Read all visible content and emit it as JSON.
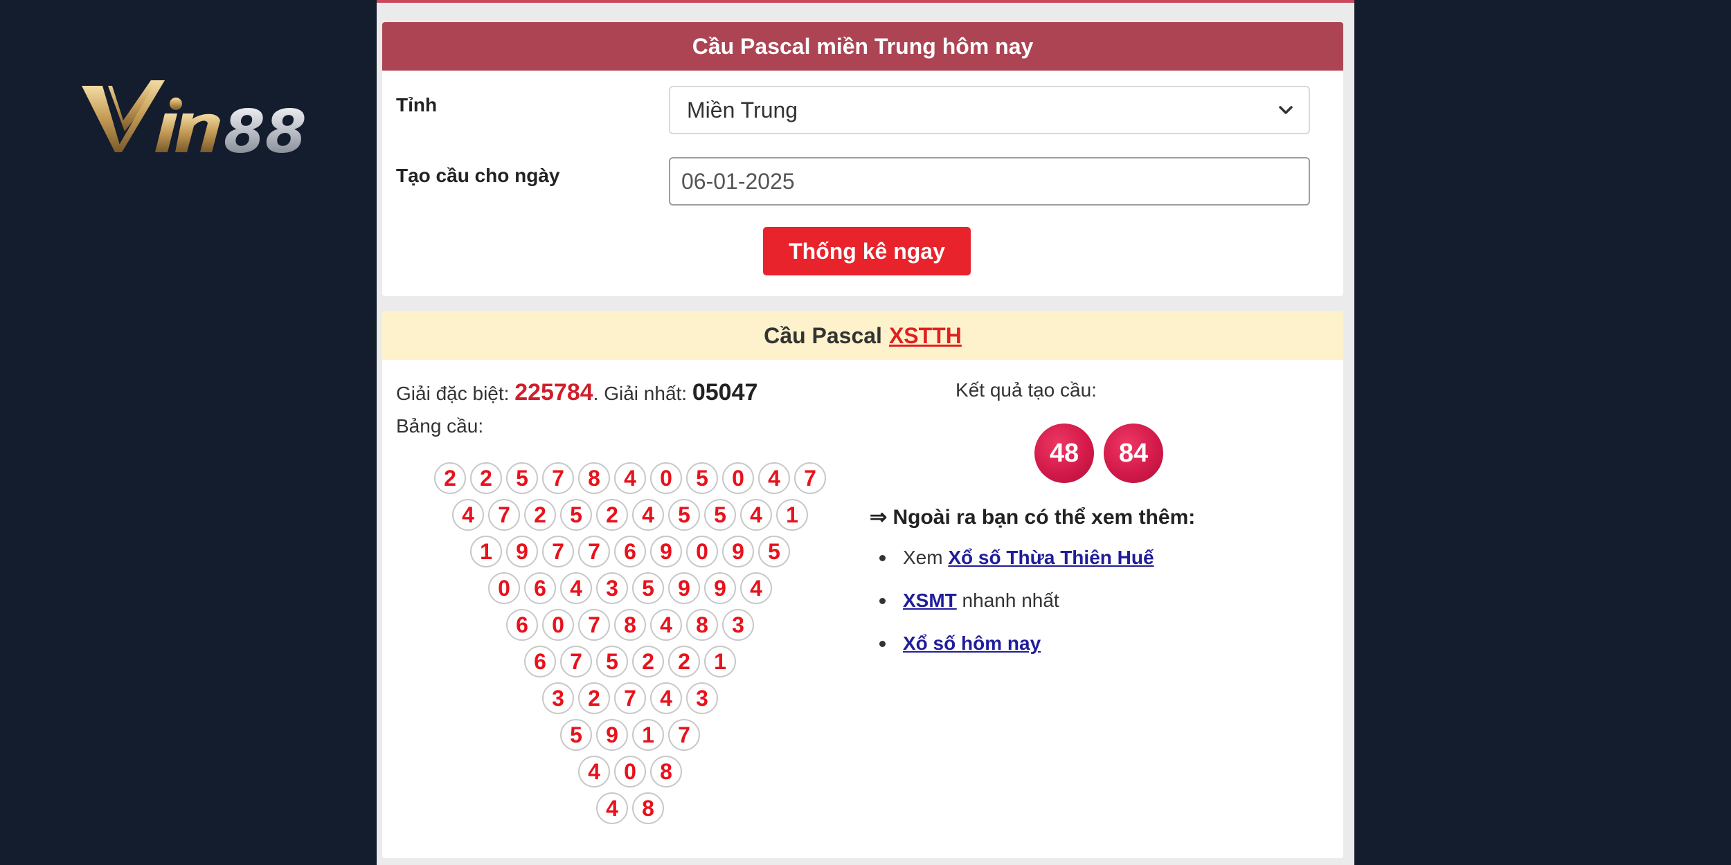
{
  "logo": {
    "text": "Vin88"
  },
  "form_card": {
    "title": "Cầu Pascal miền Trung hôm nay",
    "province_label": "Tỉnh",
    "province_value": "Miền Trung",
    "date_label": "Tạo cầu cho ngày",
    "date_value": "06-01-2025",
    "submit_label": "Thống kê ngay"
  },
  "result_card": {
    "title": "Cầu Pascal",
    "title_link": "XSTTH",
    "special_label": "Giải đặc biệt:",
    "special_value": "225784",
    "first_label": ". Giải nhất:",
    "first_value": "05047",
    "table_label": "Bảng cầu:",
    "pyramid": [
      [
        "2",
        "2",
        "5",
        "7",
        "8",
        "4",
        "0",
        "5",
        "0",
        "4",
        "7"
      ],
      [
        "4",
        "7",
        "2",
        "5",
        "2",
        "4",
        "5",
        "5",
        "4",
        "1"
      ],
      [
        "1",
        "9",
        "7",
        "7",
        "6",
        "9",
        "0",
        "9",
        "5"
      ],
      [
        "0",
        "6",
        "4",
        "3",
        "5",
        "9",
        "9",
        "4"
      ],
      [
        "6",
        "0",
        "7",
        "8",
        "4",
        "8",
        "3"
      ],
      [
        "6",
        "7",
        "5",
        "2",
        "2",
        "1"
      ],
      [
        "3",
        "2",
        "7",
        "4",
        "3"
      ],
      [
        "5",
        "9",
        "1",
        "7"
      ],
      [
        "4",
        "0",
        "8"
      ],
      [
        "4",
        "8"
      ]
    ],
    "result_label": "Kết quả tạo cầu:",
    "results": [
      "48",
      "84"
    ],
    "more_heading": "⇒ Ngoài ra bạn có thể xem thêm:",
    "links": [
      {
        "prefix": "Xem ",
        "link": "Xổ số Thừa Thiên Huế",
        "suffix": ""
      },
      {
        "prefix": "",
        "link": "XSMT",
        "suffix": " nhanh nhất"
      },
      {
        "prefix": "",
        "link": "Xổ số hôm nay",
        "suffix": ""
      }
    ]
  },
  "colors": {
    "background": "#141d2e",
    "form_header": "#ad4453",
    "result_header": "#fdf2cb",
    "button": "#e8232c",
    "ball_digit": "#e8121c",
    "result_ball": "#d31a4a",
    "link": "#1f1d9a"
  }
}
